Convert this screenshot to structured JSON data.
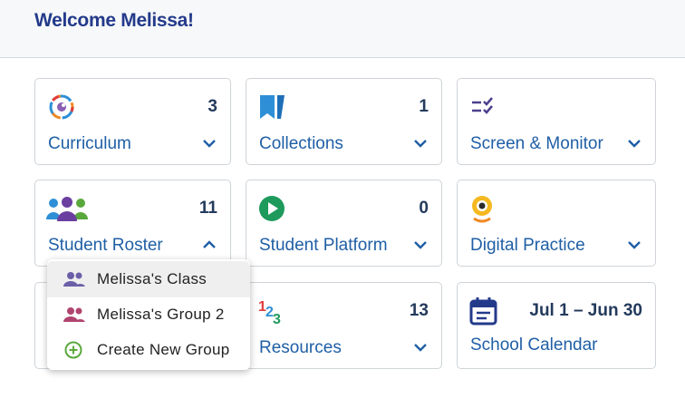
{
  "header": {
    "welcome": "Welcome Melissa!"
  },
  "cards": [
    {
      "label": "Curriculum",
      "count": "3",
      "icon": "curriculum-icon"
    },
    {
      "label": "Collections",
      "count": "1",
      "icon": "bookmark-icon"
    },
    {
      "label": "Screen & Monitor",
      "count": "",
      "icon": "checklist-icon"
    },
    {
      "label": "Student Roster",
      "count": "11",
      "icon": "people-group-icon",
      "expanded": true
    },
    {
      "label": "Student Platform",
      "count": "0",
      "icon": "play-icon"
    },
    {
      "label": "Digital Practice",
      "count": "",
      "icon": "practice-icon"
    },
    {
      "label": "",
      "count": "",
      "icon": ""
    },
    {
      "label": "Resources",
      "count": "13",
      "icon": "numbers-icon"
    },
    {
      "label": "School Calendar",
      "count": "Jul 1 – Jun 30",
      "icon": "calendar-icon"
    }
  ],
  "dropdown": {
    "items": [
      {
        "label": "Melissa's Class",
        "icon": "people-icon",
        "color": "#6b5fa8"
      },
      {
        "label": "Melissa's Group 2",
        "icon": "people-icon",
        "color": "#b0446f"
      },
      {
        "label": "Create New Group",
        "icon": "add-circle-icon",
        "color": "#5aa83c"
      }
    ]
  },
  "colors": {
    "title": "#233a8b",
    "link": "#1f5fa6",
    "count": "#233a5c"
  }
}
